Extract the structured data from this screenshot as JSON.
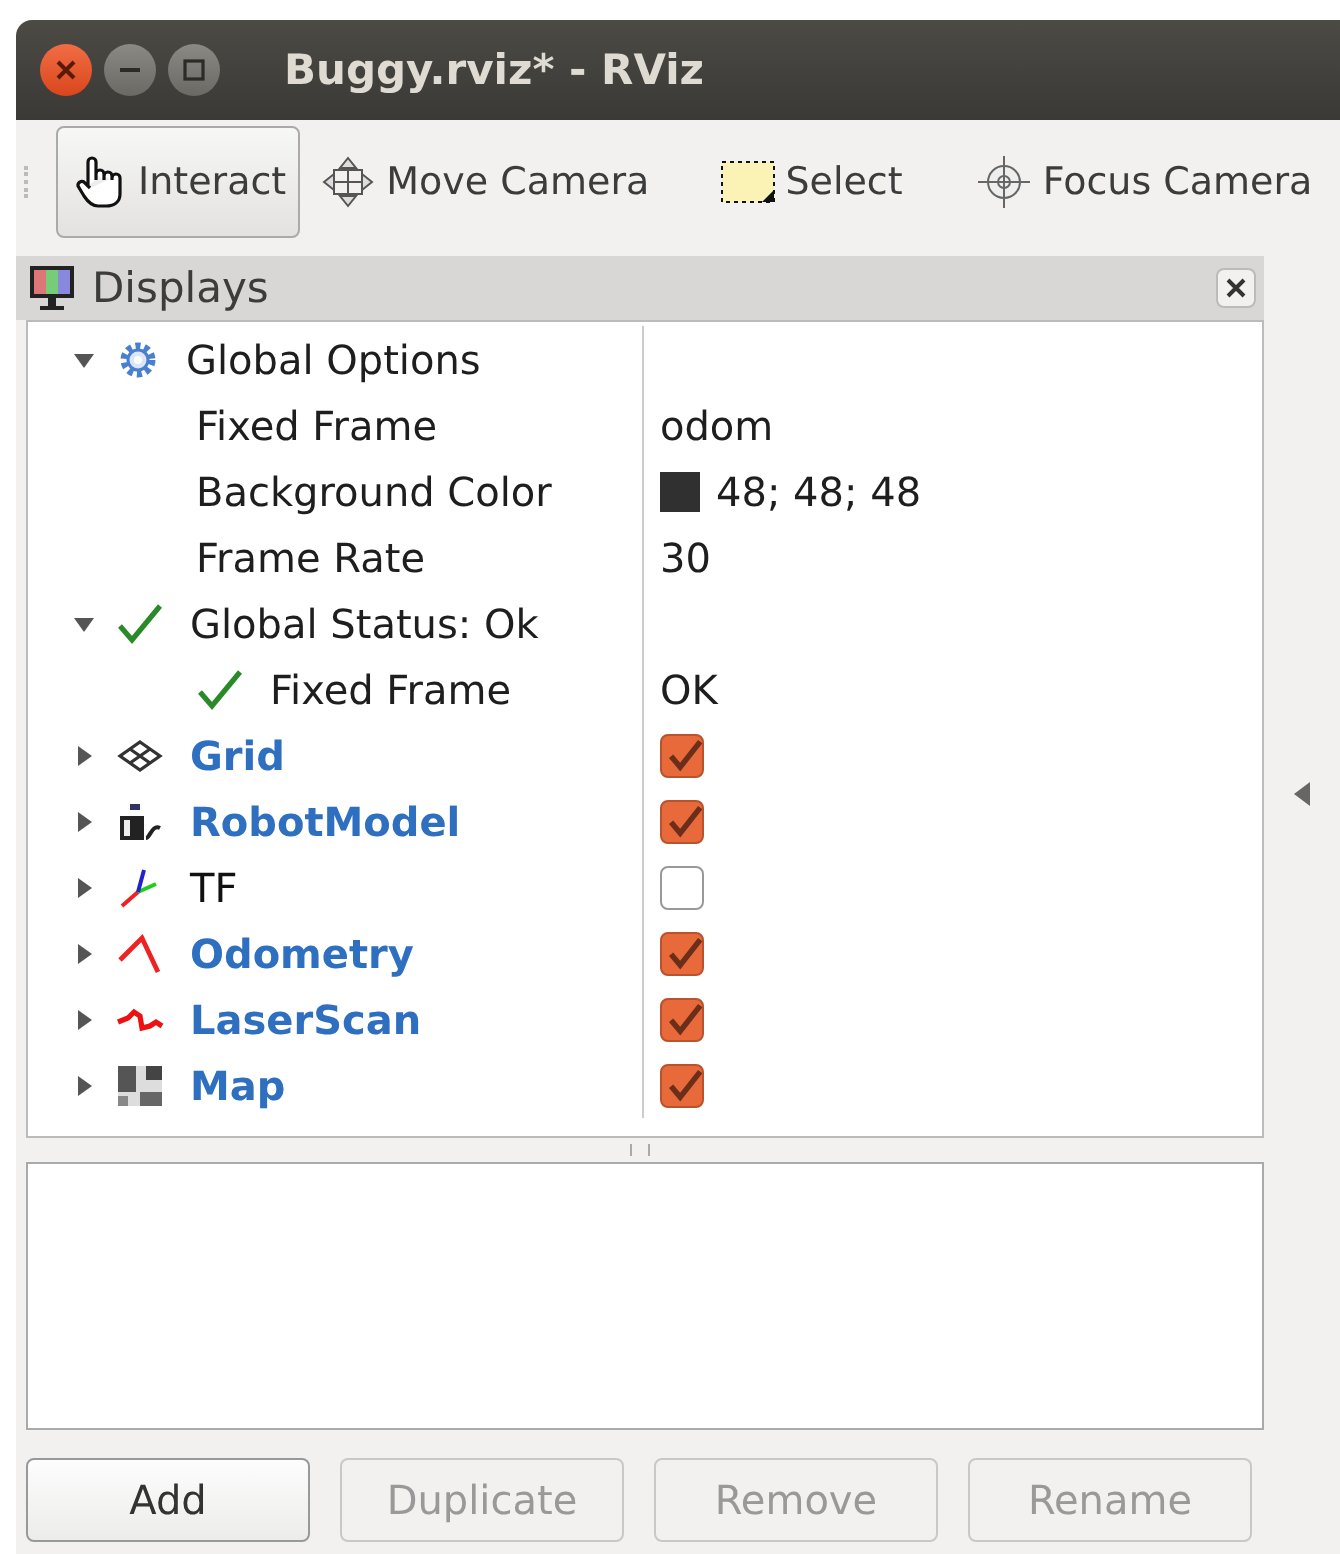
{
  "window": {
    "title": "Buggy.rviz* - RViz"
  },
  "toolbar": [
    {
      "kind": "interact",
      "label": "Interact",
      "selected": true
    },
    {
      "kind": "move_camera",
      "label": "Move Camera",
      "selected": false
    },
    {
      "kind": "select",
      "label": "Select",
      "selected": false
    },
    {
      "kind": "focus_camera",
      "label": "Focus Camera",
      "selected": false
    }
  ],
  "displays_panel": {
    "title": "Displays",
    "tree": [
      {
        "kind": "options",
        "label": "Global Options",
        "expanded": true,
        "children": [
          {
            "kind": "property",
            "label": "Fixed Frame",
            "value": "odom"
          },
          {
            "kind": "color_property",
            "label": "Background Color",
            "value": "48; 48; 48",
            "color": "#303030"
          },
          {
            "kind": "property",
            "label": "Frame Rate",
            "value": "30"
          }
        ]
      },
      {
        "kind": "status",
        "label": "Global Status: Ok",
        "expanded": true,
        "children": [
          {
            "kind": "status",
            "label": "Fixed Frame",
            "value": "OK"
          }
        ]
      },
      {
        "kind": "grid",
        "label": "Grid",
        "expanded": false,
        "checked": true
      },
      {
        "kind": "robot_model",
        "label": "RobotModel",
        "expanded": false,
        "checked": true
      },
      {
        "kind": "tf",
        "label": "TF",
        "expanded": false,
        "checked": false
      },
      {
        "kind": "odometry",
        "label": "Odometry",
        "expanded": false,
        "checked": true
      },
      {
        "kind": "laser_scan",
        "label": "LaserScan",
        "expanded": false,
        "checked": true
      },
      {
        "kind": "map",
        "label": "Map",
        "expanded": false,
        "checked": true
      }
    ]
  },
  "buttons": [
    {
      "label": "Add",
      "disabled": false
    },
    {
      "label": "Duplicate",
      "disabled": true
    },
    {
      "label": "Remove",
      "disabled": true
    },
    {
      "label": "Rename",
      "disabled": true
    }
  ]
}
